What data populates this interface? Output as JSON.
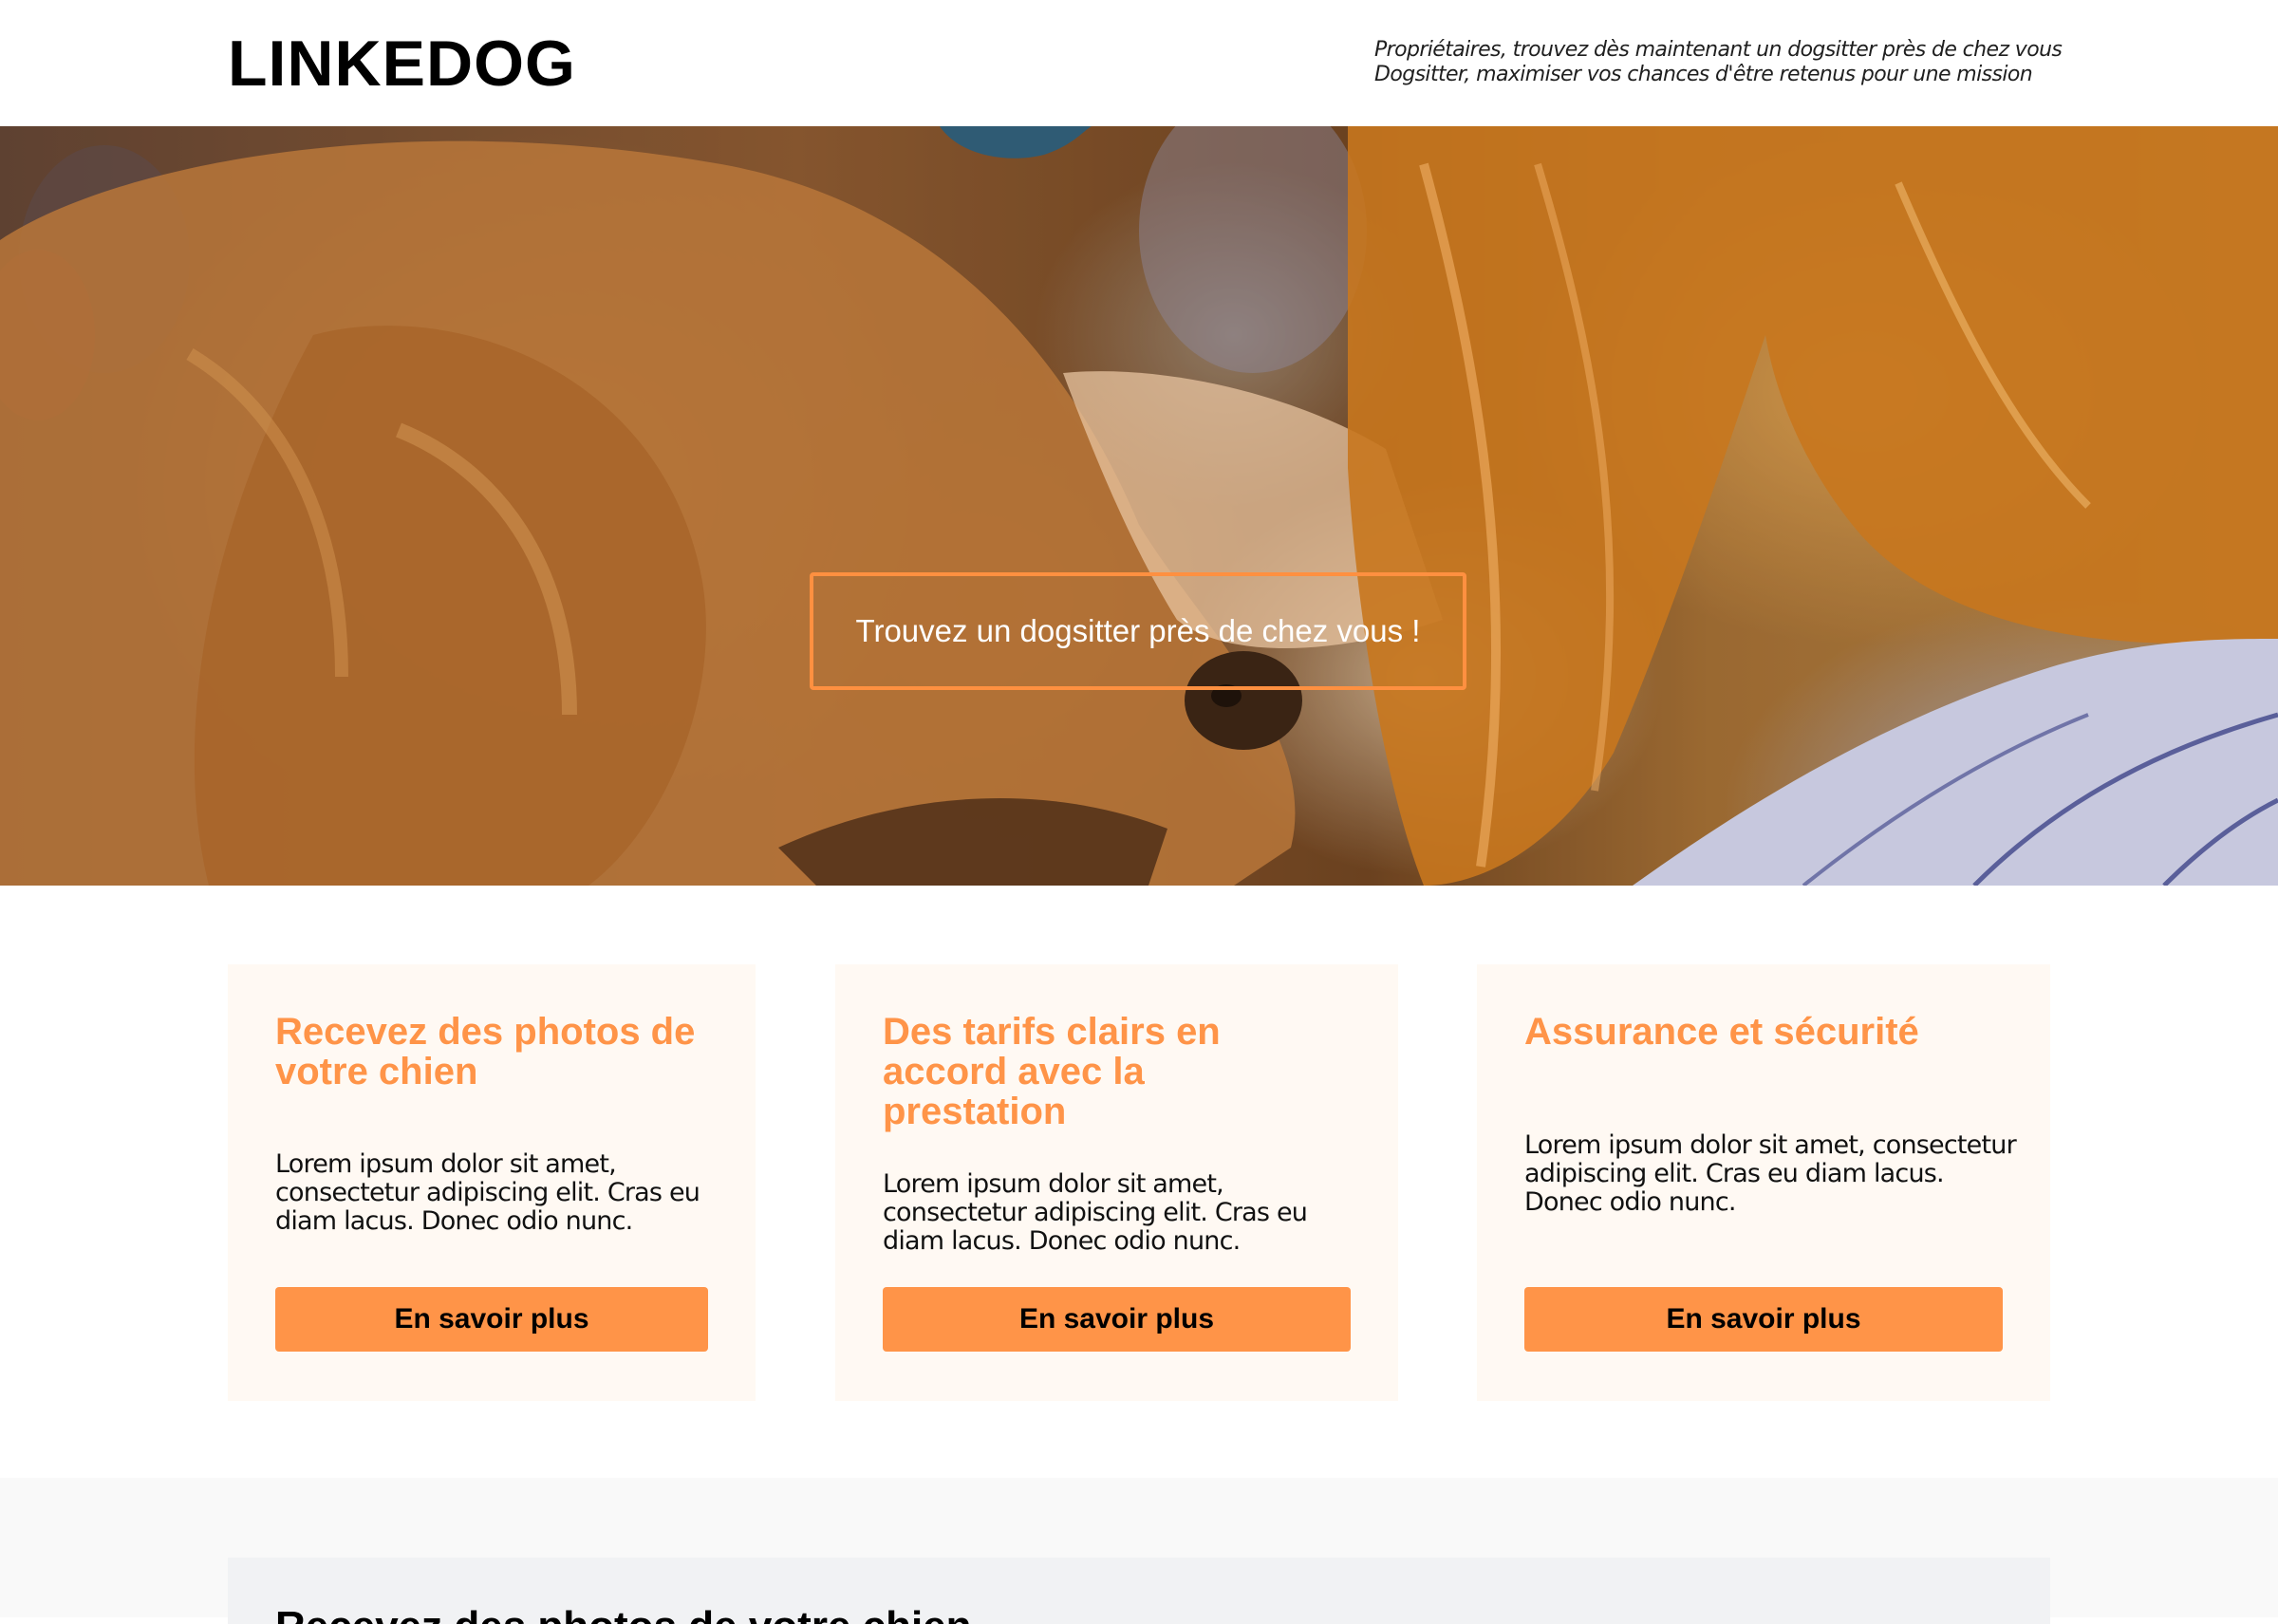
{
  "header": {
    "logo": "LINKEDOG",
    "tagline_owners": "Propriétaires, trouvez dès maintenant un dogsitter près de chez vous",
    "tagline_sitters": "Dogsitter, maximiser vos chances d'être retenus pour une mission"
  },
  "hero": {
    "cta_label": "Trouvez un dogsitter près de chez vous !"
  },
  "features": [
    {
      "title": "Recevez des photos de votre chien",
      "text": "Lorem ipsum dolor sit amet, consectetur adipiscing elit. Cras eu diam lacus. Donec odio nunc.",
      "button": "En savoir plus"
    },
    {
      "title": "Des tarifs clairs en accord avec la prestation",
      "text": "Lorem ipsum dolor sit amet, consectetur adipiscing elit. Cras eu diam lacus. Donec odio nunc.",
      "button": "En savoir plus"
    },
    {
      "title": "Assurance et sécurité",
      "text": "Lorem ipsum dolor sit amet, consectetur adipiscing elit. Cras eu diam lacus. Donec odio nunc.",
      "button": "En savoir plus"
    }
  ],
  "bottom": {
    "title": "Recevez des photos de votre chien"
  },
  "colors": {
    "accent": "#ff9448",
    "card_bg": "#fff9f3",
    "section_bg": "#f9f9f9"
  }
}
